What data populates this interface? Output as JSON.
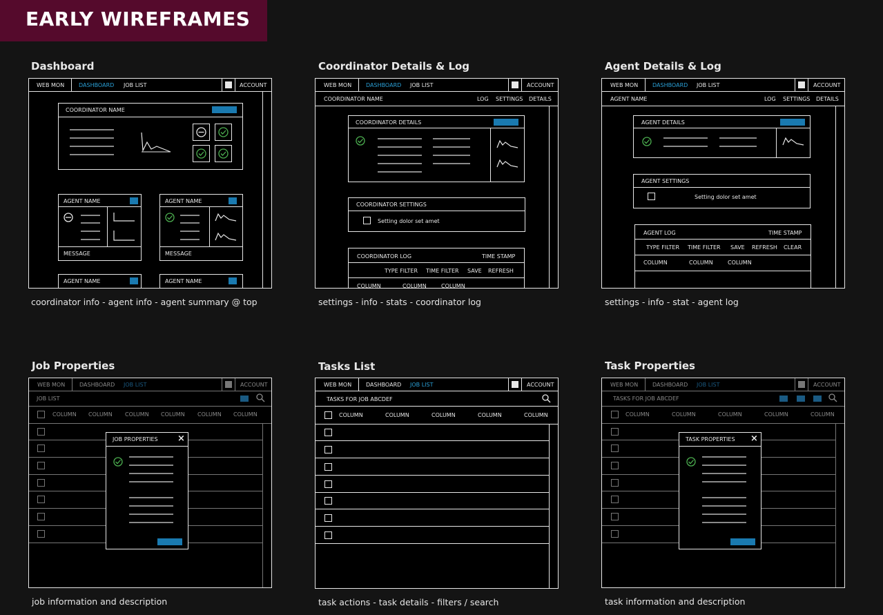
{
  "banner": "EARLY WIREFRAMES",
  "colors": {
    "banner": "#550a2c",
    "accent": "#2a9fd6",
    "check": "#4caf50"
  },
  "nav": {
    "webmon": "WEB MON",
    "dashboard": "DASHBOARD",
    "joblist": "JOB LIST",
    "account": "ACCOUNT"
  },
  "tabs": {
    "log": "LOG",
    "settings": "SETTINGS",
    "details": "DETAILS"
  },
  "panels": [
    {
      "title": "Dashboard",
      "caption": "coordinator info - agent info - agent summary @ top"
    },
    {
      "title": "Coordinator Details & Log",
      "caption": "settings - info - stats - coordinator log"
    },
    {
      "title": "Agent Details & Log",
      "caption": "settings - info - stat - agent log"
    },
    {
      "title": "Job Properties",
      "caption": "job information and description"
    },
    {
      "title": "Tasks List",
      "caption": "task actions - task  details - filters / search"
    },
    {
      "title": "Task Properties",
      "caption": "task information and description"
    }
  ],
  "dashboard": {
    "coordinator_name": "COORDINATOR NAME",
    "agent_name": "AGENT NAME",
    "message": "MESSAGE"
  },
  "coord": {
    "subnav": "COORDINATOR NAME",
    "details": "COORDINATOR DETAILS",
    "settings": "COORDINATOR SETTINGS",
    "setting_text": "Setting dolor set amet",
    "log": "COORDINATOR  LOG",
    "time_stamp": "TIME STAMP",
    "type_filter": "TYPE FILTER",
    "time_filter": "TIME FILTER",
    "save": "SAVE",
    "refresh": "REFRESH",
    "column": "COLUMN"
  },
  "agent": {
    "subnav": "AGENT NAME",
    "details": "AGENT DETAILS",
    "settings": "AGENT SETTINGS",
    "setting_text": "Setting dolor set amet",
    "log": "AGENT LOG",
    "time_stamp": "TIME STAMP",
    "type_filter": "TYPE FILTER",
    "time_filter": "TIME FILTER",
    "save": "SAVE",
    "refresh": "REFRESH",
    "clear": "CLEAR",
    "column": "COLUMN"
  },
  "job": {
    "subnav": "JOB LIST",
    "column": "COLUMN",
    "modal_title": "JOB PROPERTIES",
    "close": "×"
  },
  "tasks": {
    "subnav": "TASKS FOR JOB ABCDEF",
    "column": "COLUMN"
  },
  "task": {
    "subnav": "TASKS FOR JOB ABCDEF",
    "column": "COLUMN",
    "modal_title": "TASK PROPERTIES",
    "close": "×"
  }
}
